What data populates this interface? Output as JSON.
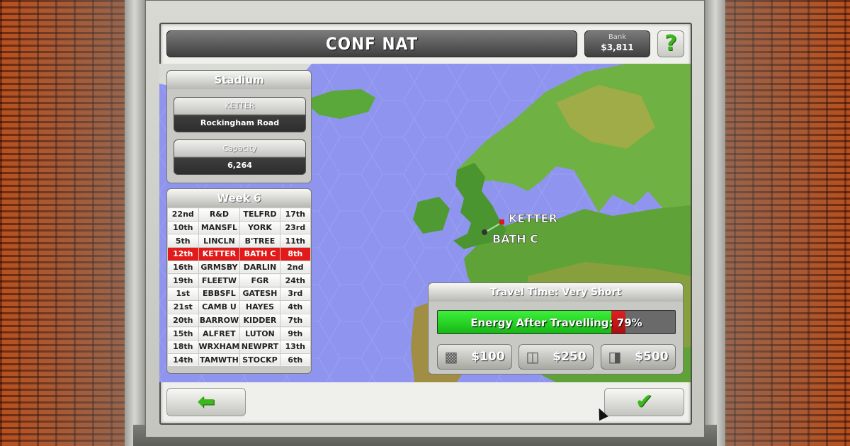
{
  "header": {
    "title": "CONF NAT",
    "bank_label": "Bank",
    "bank_value": "$3,811",
    "help_label": "?"
  },
  "stadium": {
    "heading": "Stadium",
    "team": "KETTER",
    "ground": "Rockingham Road",
    "capacity_label": "Capacity",
    "capacity_value": "6,264"
  },
  "week": {
    "heading": "Week 6",
    "highlight_row": 3,
    "fixtures": [
      [
        "22nd",
        "R&D",
        "TELFRD",
        "17th"
      ],
      [
        "10th",
        "MANSFL",
        "YORK",
        "23rd"
      ],
      [
        "5th",
        "LINCLN",
        "B'TREE",
        "11th"
      ],
      [
        "12th",
        "KETTER",
        "BATH C",
        "8th"
      ],
      [
        "16th",
        "GRMSBY",
        "DARLIN",
        "2nd"
      ],
      [
        "19th",
        "FLEETW",
        "FGR",
        "24th"
      ],
      [
        "1st",
        "EBBSFL",
        "GATESH",
        "3rd"
      ],
      [
        "21st",
        "CAMB U",
        "HAYES",
        "4th"
      ],
      [
        "20th",
        "BARROW",
        "KIDDER",
        "7th"
      ],
      [
        "15th",
        "ALFRET",
        "LUTON",
        "9th"
      ],
      [
        "18th",
        "WRXHAM",
        "NEWPRT",
        "13th"
      ],
      [
        "14th",
        "TAMWTH",
        "STOCKP",
        "6th"
      ]
    ]
  },
  "map": {
    "home_label": "KETTER",
    "away_label": "BATH C"
  },
  "travel": {
    "heading": "Travel Time: Very Short",
    "energy_text": "Energy After Travelling: 79%",
    "energy_percent": 79,
    "options": [
      {
        "icon": "bus-icon",
        "price": "$100"
      },
      {
        "icon": "train-icon",
        "price": "$250"
      },
      {
        "icon": "plane-icon",
        "price": "$500"
      }
    ]
  },
  "colors": {
    "accent_green": "#3bb81b",
    "highlight_red": "#e21a1a",
    "sea": "#8f95ee"
  }
}
